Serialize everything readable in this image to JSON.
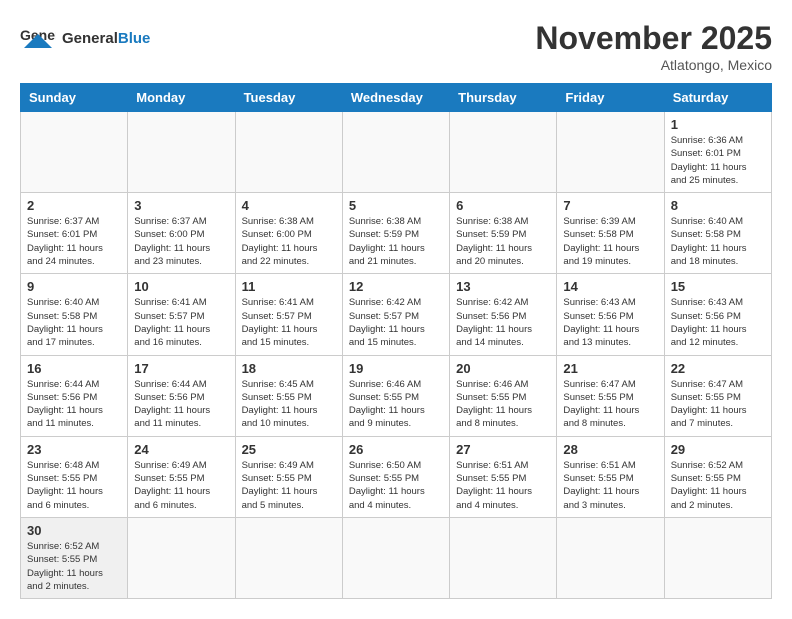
{
  "header": {
    "logo_general": "General",
    "logo_blue": "Blue",
    "month_title": "November 2025",
    "location": "Atlatongo, Mexico"
  },
  "days_of_week": [
    "Sunday",
    "Monday",
    "Tuesday",
    "Wednesday",
    "Thursday",
    "Friday",
    "Saturday"
  ],
  "weeks": [
    [
      {
        "day": "",
        "info": ""
      },
      {
        "day": "",
        "info": ""
      },
      {
        "day": "",
        "info": ""
      },
      {
        "day": "",
        "info": ""
      },
      {
        "day": "",
        "info": ""
      },
      {
        "day": "",
        "info": ""
      },
      {
        "day": "1",
        "info": "Sunrise: 6:36 AM\nSunset: 6:01 PM\nDaylight: 11 hours\nand 25 minutes."
      }
    ],
    [
      {
        "day": "2",
        "info": "Sunrise: 6:37 AM\nSunset: 6:01 PM\nDaylight: 11 hours\nand 24 minutes."
      },
      {
        "day": "3",
        "info": "Sunrise: 6:37 AM\nSunset: 6:00 PM\nDaylight: 11 hours\nand 23 minutes."
      },
      {
        "day": "4",
        "info": "Sunrise: 6:38 AM\nSunset: 6:00 PM\nDaylight: 11 hours\nand 22 minutes."
      },
      {
        "day": "5",
        "info": "Sunrise: 6:38 AM\nSunset: 5:59 PM\nDaylight: 11 hours\nand 21 minutes."
      },
      {
        "day": "6",
        "info": "Sunrise: 6:38 AM\nSunset: 5:59 PM\nDaylight: 11 hours\nand 20 minutes."
      },
      {
        "day": "7",
        "info": "Sunrise: 6:39 AM\nSunset: 5:58 PM\nDaylight: 11 hours\nand 19 minutes."
      },
      {
        "day": "8",
        "info": "Sunrise: 6:40 AM\nSunset: 5:58 PM\nDaylight: 11 hours\nand 18 minutes."
      }
    ],
    [
      {
        "day": "9",
        "info": "Sunrise: 6:40 AM\nSunset: 5:58 PM\nDaylight: 11 hours\nand 17 minutes."
      },
      {
        "day": "10",
        "info": "Sunrise: 6:41 AM\nSunset: 5:57 PM\nDaylight: 11 hours\nand 16 minutes."
      },
      {
        "day": "11",
        "info": "Sunrise: 6:41 AM\nSunset: 5:57 PM\nDaylight: 11 hours\nand 15 minutes."
      },
      {
        "day": "12",
        "info": "Sunrise: 6:42 AM\nSunset: 5:57 PM\nDaylight: 11 hours\nand 15 minutes."
      },
      {
        "day": "13",
        "info": "Sunrise: 6:42 AM\nSunset: 5:56 PM\nDaylight: 11 hours\nand 14 minutes."
      },
      {
        "day": "14",
        "info": "Sunrise: 6:43 AM\nSunset: 5:56 PM\nDaylight: 11 hours\nand 13 minutes."
      },
      {
        "day": "15",
        "info": "Sunrise: 6:43 AM\nSunset: 5:56 PM\nDaylight: 11 hours\nand 12 minutes."
      }
    ],
    [
      {
        "day": "16",
        "info": "Sunrise: 6:44 AM\nSunset: 5:56 PM\nDaylight: 11 hours\nand 11 minutes."
      },
      {
        "day": "17",
        "info": "Sunrise: 6:44 AM\nSunset: 5:56 PM\nDaylight: 11 hours\nand 11 minutes."
      },
      {
        "day": "18",
        "info": "Sunrise: 6:45 AM\nSunset: 5:55 PM\nDaylight: 11 hours\nand 10 minutes."
      },
      {
        "day": "19",
        "info": "Sunrise: 6:46 AM\nSunset: 5:55 PM\nDaylight: 11 hours\nand 9 minutes."
      },
      {
        "day": "20",
        "info": "Sunrise: 6:46 AM\nSunset: 5:55 PM\nDaylight: 11 hours\nand 8 minutes."
      },
      {
        "day": "21",
        "info": "Sunrise: 6:47 AM\nSunset: 5:55 PM\nDaylight: 11 hours\nand 8 minutes."
      },
      {
        "day": "22",
        "info": "Sunrise: 6:47 AM\nSunset: 5:55 PM\nDaylight: 11 hours\nand 7 minutes."
      }
    ],
    [
      {
        "day": "23",
        "info": "Sunrise: 6:48 AM\nSunset: 5:55 PM\nDaylight: 11 hours\nand 6 minutes."
      },
      {
        "day": "24",
        "info": "Sunrise: 6:49 AM\nSunset: 5:55 PM\nDaylight: 11 hours\nand 6 minutes."
      },
      {
        "day": "25",
        "info": "Sunrise: 6:49 AM\nSunset: 5:55 PM\nDaylight: 11 hours\nand 5 minutes."
      },
      {
        "day": "26",
        "info": "Sunrise: 6:50 AM\nSunset: 5:55 PM\nDaylight: 11 hours\nand 4 minutes."
      },
      {
        "day": "27",
        "info": "Sunrise: 6:51 AM\nSunset: 5:55 PM\nDaylight: 11 hours\nand 4 minutes."
      },
      {
        "day": "28",
        "info": "Sunrise: 6:51 AM\nSunset: 5:55 PM\nDaylight: 11 hours\nand 3 minutes."
      },
      {
        "day": "29",
        "info": "Sunrise: 6:52 AM\nSunset: 5:55 PM\nDaylight: 11 hours\nand 2 minutes."
      }
    ],
    [
      {
        "day": "30",
        "info": "Sunrise: 6:52 AM\nSunset: 5:55 PM\nDaylight: 11 hours\nand 2 minutes."
      },
      {
        "day": "",
        "info": ""
      },
      {
        "day": "",
        "info": ""
      },
      {
        "day": "",
        "info": ""
      },
      {
        "day": "",
        "info": ""
      },
      {
        "day": "",
        "info": ""
      },
      {
        "day": "",
        "info": ""
      }
    ]
  ]
}
